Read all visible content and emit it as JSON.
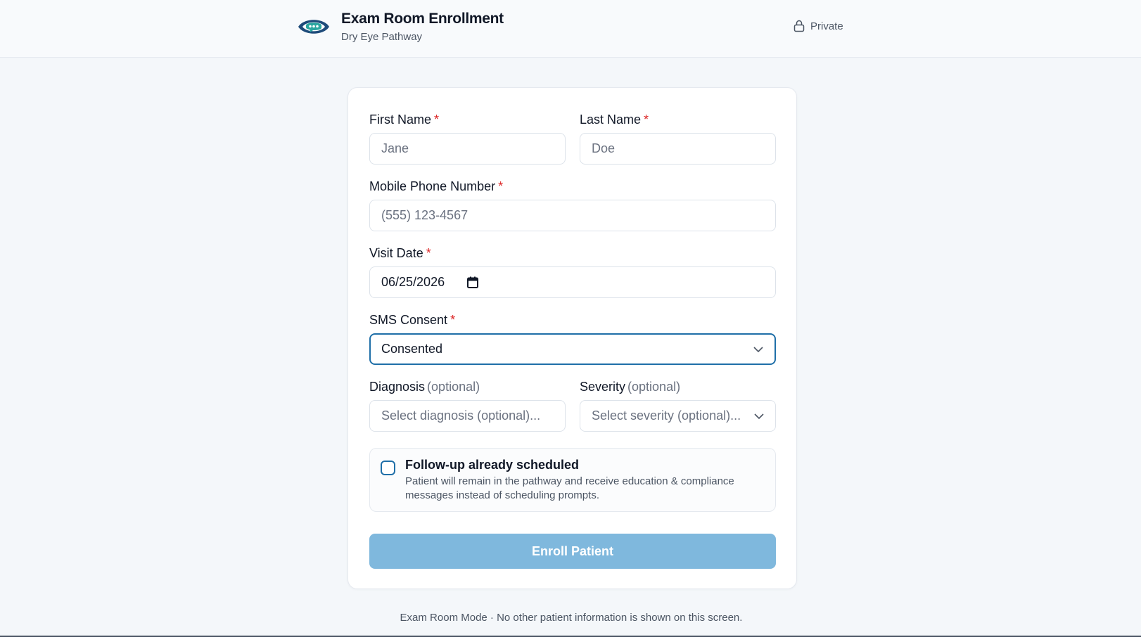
{
  "header": {
    "title": "Exam Room Enrollment",
    "subtitle": "Dry Eye Pathway",
    "privacy_label": "Private",
    "logo_icon": "eye-chat-icon"
  },
  "form": {
    "first_name": {
      "label": "First Name",
      "required_mark": "*",
      "placeholder": "Jane"
    },
    "last_name": {
      "label": "Last Name",
      "required_mark": "*",
      "placeholder": "Doe"
    },
    "phone": {
      "label": "Mobile Phone Number",
      "required_mark": "*",
      "placeholder": "(555) 123-4567"
    },
    "visit_date": {
      "label": "Visit Date",
      "required_mark": "*",
      "value": "06/25/2026"
    },
    "sms_consent": {
      "label": "SMS Consent",
      "required_mark": "*",
      "value": "Consented"
    },
    "diagnosis": {
      "label": "Diagnosis",
      "optional_text": "(optional)",
      "placeholder": "Select diagnosis (optional)..."
    },
    "severity": {
      "label": "Severity",
      "optional_text": "(optional)",
      "placeholder": "Select severity (optional)..."
    },
    "followup": {
      "checked": false,
      "title": "Follow-up already scheduled",
      "description": "Patient will remain in the pathway and receive education & compliance messages instead of scheduling prompts."
    },
    "submit_label": "Enroll Patient"
  },
  "footer": {
    "note": "Exam Room Mode · No other patient information is shown on this screen."
  },
  "colors": {
    "accent": "#1f6fa8",
    "button_disabled": "#7fb8dd",
    "required": "#dc2626",
    "logo_dark": "#1e4b7a",
    "logo_teal": "#2aa6a0"
  }
}
